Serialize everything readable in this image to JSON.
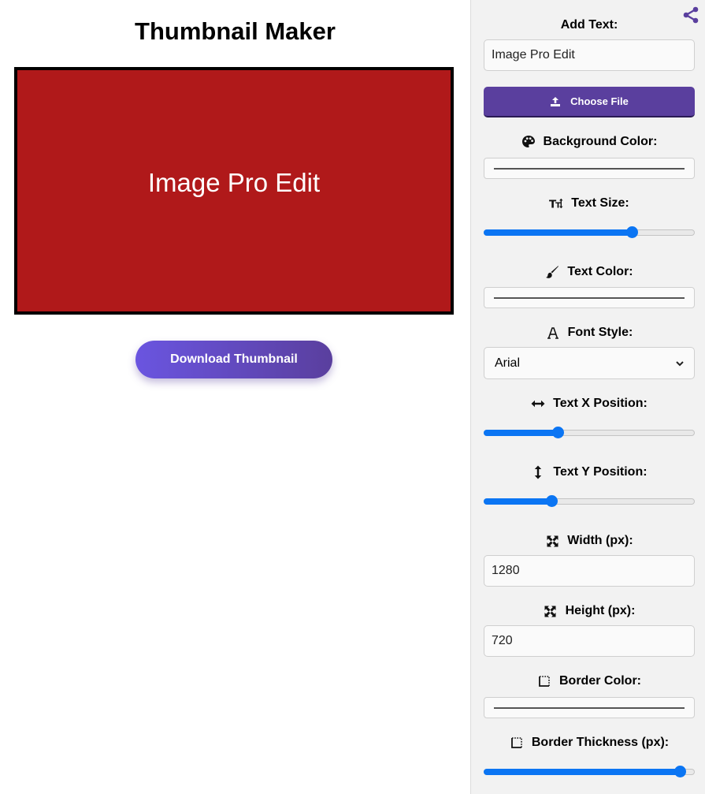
{
  "title": "Thumbnail Maker",
  "canvas": {
    "text": "Image Pro Edit",
    "background_color": "#b0191a",
    "text_color": "#ffffff",
    "border_color": "#000000"
  },
  "download_label": "Download Thumbnail",
  "sidebar": {
    "share_icon": "share-icon",
    "add_text": {
      "label": "Add Text:",
      "value": "Image Pro Edit"
    },
    "choose_file_label": "Choose File",
    "background_color": {
      "label": "Background Color:",
      "icon": "palette-icon"
    },
    "text_size": {
      "label": "Text Size:",
      "icon": "text-size-icon",
      "fraction": 0.7
    },
    "text_color": {
      "label": "Text Color:",
      "icon": "brush-icon"
    },
    "font_style": {
      "label": "Font Style:",
      "icon": "font-icon",
      "selected": "Arial"
    },
    "text_x": {
      "label": "Text X Position:",
      "icon": "arrows-horizontal-icon",
      "fraction": 0.35
    },
    "text_y": {
      "label": "Text Y Position:",
      "icon": "arrows-vertical-icon",
      "fraction": 0.32
    },
    "width": {
      "label": "Width (px):",
      "icon": "expand-icon",
      "value": "1280"
    },
    "height": {
      "label": "Height (px):",
      "icon": "expand-icon",
      "value": "720"
    },
    "border_color": {
      "label": "Border Color:",
      "icon": "border-icon"
    },
    "border_thickness": {
      "label": "Border Thickness (px):",
      "icon": "border-icon",
      "fraction": 0.93
    }
  },
  "colors": {
    "accent": "#5a3f9e",
    "slider": "#0b75f3"
  }
}
